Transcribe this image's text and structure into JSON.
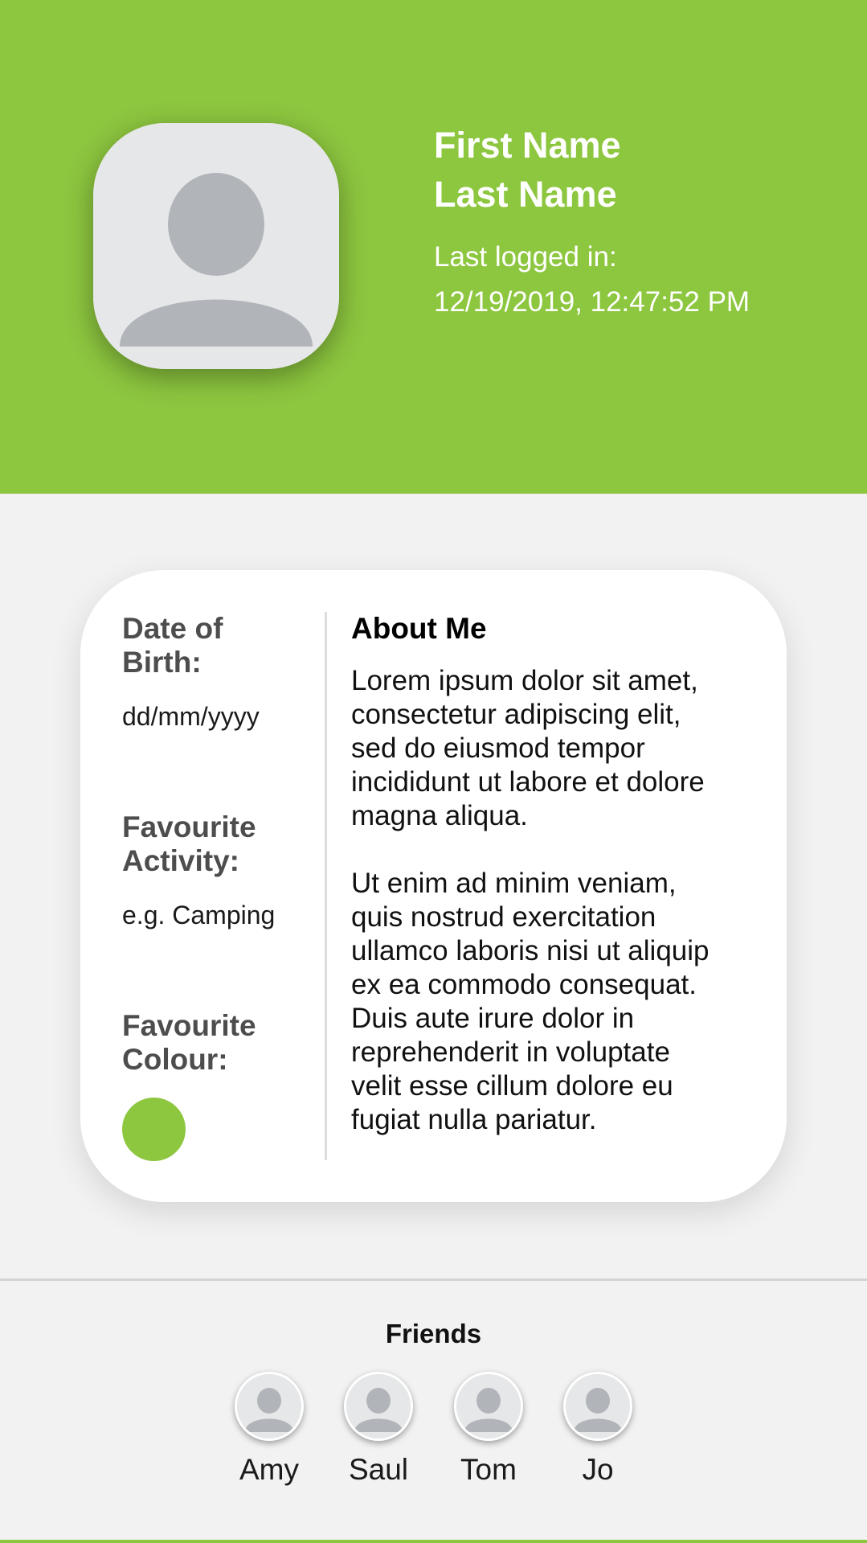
{
  "profile": {
    "first_name": "First Name",
    "last_name": "Last Name",
    "last_logged_label": "Last logged in:",
    "last_logged_value": "12/19/2019, 12:47:52 PM"
  },
  "details": {
    "dob_label_line1": "Date of",
    "dob_label_line2": "Birth:",
    "dob_value": "dd/mm/yyyy",
    "activity_label_line1": "Favourite",
    "activity_label_line2": "Activity:",
    "activity_value": "e.g. Camping",
    "colour_label_line1": "Favourite",
    "colour_label_line2": "Colour:",
    "colour_value": "#8dc63f"
  },
  "about": {
    "title": "About Me",
    "para1_lines": [
      "Lorem ipsum dolor sit amet,",
      "consectetur adipiscing elit,",
      "sed do eiusmod tempor",
      "incididunt ut labore et dolore",
      "magna aliqua."
    ],
    "para2_lines": [
      "Ut enim ad minim veniam,",
      "quis nostrud exercitation",
      "ullamco laboris nisi ut aliquip",
      "ex ea commodo consequat.",
      "Duis aute irure dolor in",
      "reprehenderit in voluptate",
      "velit esse cillum dolore eu",
      "fugiat nulla pariatur."
    ]
  },
  "friends": {
    "title": "Friends",
    "list": [
      {
        "name": "Amy"
      },
      {
        "name": "Saul"
      },
      {
        "name": "Tom"
      },
      {
        "name": "Jo"
      }
    ]
  },
  "colors": {
    "accent": "#8dc63f",
    "avatar_bg": "#e6e7e8",
    "avatar_fg": "#b1b5b9",
    "background": "#f2f2f2"
  },
  "icons": {
    "profile_avatar": "user-silhouette-icon",
    "friend_avatar": "user-silhouette-icon"
  }
}
